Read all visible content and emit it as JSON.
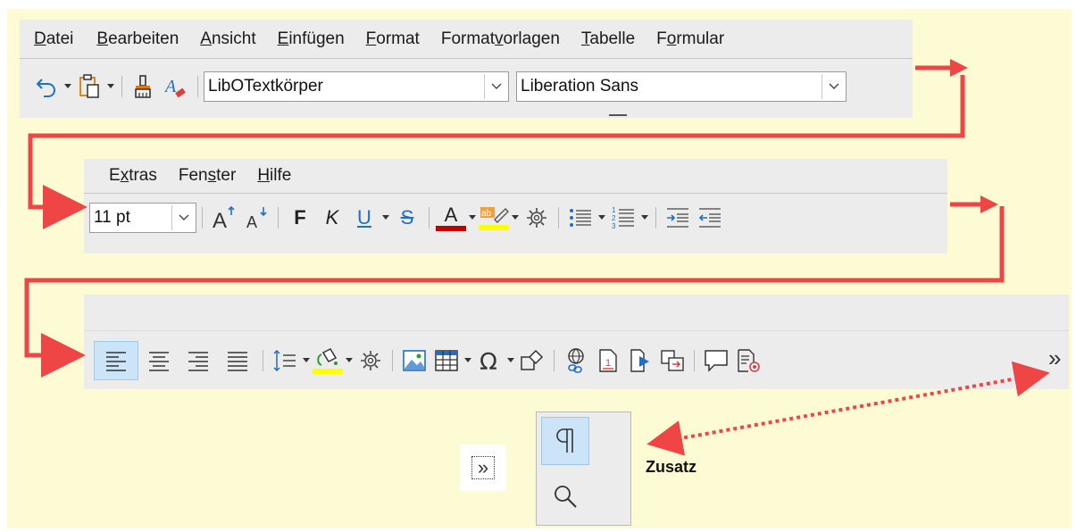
{
  "menu1": [
    "Datei",
    "Bearbeiten",
    "Ansicht",
    "Einfügen",
    "Format",
    "Formatvorlagen",
    "Tabelle",
    "Formular"
  ],
  "menu1_underline": [
    "D",
    "B",
    "A",
    "E",
    "F",
    "v",
    "T",
    "o"
  ],
  "menu2": [
    "Extras",
    "Fenster",
    "Hilfe"
  ],
  "paragraph_style": "LibOTextkörper",
  "font_name": "Liberation Sans",
  "font_size": "11 pt",
  "bold_label": "F",
  "italic_label": "K",
  "underline_label": "U",
  "strike_label": "S",
  "font_color_label": "A",
  "more_glyph": "»",
  "popup_more_glyph": "»",
  "zusatz_label": "Zusatz",
  "colors": {
    "accent_red": "#f04545",
    "font_color_bar": "#c00000",
    "highlight_bar": "#ffff00",
    "active_bg": "#cce4f7",
    "icon_blue": "#1e6fc5"
  }
}
